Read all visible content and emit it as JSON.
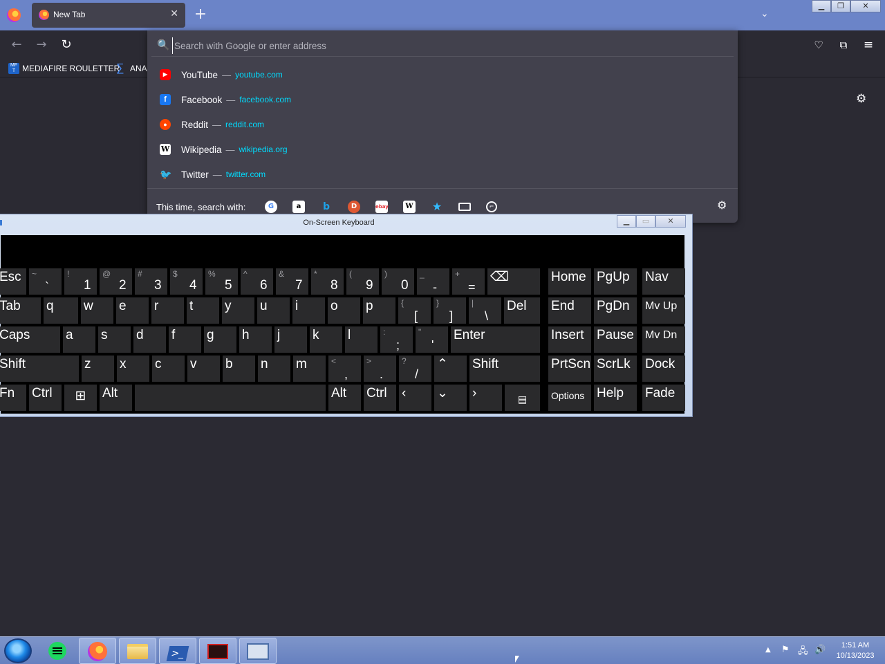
{
  "browser": {
    "tab_title": "New Tab",
    "tab_close": "✕",
    "new_tab": "+",
    "list_tabs": "⌄"
  },
  "bookmarks": [
    {
      "label": "MEDIAFIRE ROULETTER",
      "icon": "mediafire-icon"
    },
    {
      "label": "ANA",
      "icon": "sigma-icon"
    }
  ],
  "urlbar": {
    "placeholder": "Search with Google or enter address",
    "value": ""
  },
  "suggestions": [
    {
      "name": "YouTube",
      "url": "youtube.com",
      "icon": "youtube-icon"
    },
    {
      "name": "Facebook",
      "url": "facebook.com",
      "icon": "facebook-icon"
    },
    {
      "name": "Reddit",
      "url": "reddit.com",
      "icon": "reddit-icon"
    },
    {
      "name": "Wikipedia",
      "url": "wikipedia.org",
      "icon": "wikipedia-icon"
    },
    {
      "name": "Twitter",
      "url": "twitter.com",
      "icon": "twitter-icon"
    }
  ],
  "dash": "—",
  "oneoff": {
    "label": "This time, search with:",
    "engines": [
      "google-icon",
      "amazon-icon",
      "bing-icon",
      "duckduckgo-icon",
      "ebay-icon",
      "wikipedia-icon",
      "bookmarks-icon",
      "tabs-icon",
      "history-icon"
    ]
  },
  "osk": {
    "title": "On-Screen Keyboard",
    "rows": {
      "r1": [
        {
          "main": "Esc"
        },
        {
          "shift": "~",
          "low": "`"
        },
        {
          "shift": "!",
          "low": "1"
        },
        {
          "shift": "@",
          "low": "2"
        },
        {
          "shift": "#",
          "low": "3"
        },
        {
          "shift": "$",
          "low": "4"
        },
        {
          "shift": "%",
          "low": "5"
        },
        {
          "shift": "^",
          "low": "6"
        },
        {
          "shift": "&",
          "low": "7"
        },
        {
          "shift": "*",
          "low": "8"
        },
        {
          "shift": "(",
          "low": "9"
        },
        {
          "shift": ")",
          "low": "0"
        },
        {
          "shift": "_",
          "low": "-"
        },
        {
          "shift": "+",
          "low": "="
        },
        {
          "main": "⌫"
        },
        {
          "main": "Home"
        },
        {
          "main": "PgUp"
        },
        {
          "main": "Nav"
        }
      ],
      "r2": [
        {
          "main": "Tab"
        },
        {
          "main": "q"
        },
        {
          "main": "w"
        },
        {
          "main": "e"
        },
        {
          "main": "r"
        },
        {
          "main": "t"
        },
        {
          "main": "y"
        },
        {
          "main": "u"
        },
        {
          "main": "i"
        },
        {
          "main": "o"
        },
        {
          "main": "p"
        },
        {
          "shift": "{",
          "low": "["
        },
        {
          "shift": "}",
          "low": "]"
        },
        {
          "shift": "|",
          "low": "\\"
        },
        {
          "main": "Del"
        },
        {
          "main": "End"
        },
        {
          "main": "PgDn"
        },
        {
          "main": "Mv Up"
        }
      ],
      "r3": [
        {
          "main": "Caps"
        },
        {
          "main": "a"
        },
        {
          "main": "s"
        },
        {
          "main": "d"
        },
        {
          "main": "f"
        },
        {
          "main": "g"
        },
        {
          "main": "h"
        },
        {
          "main": "j"
        },
        {
          "main": "k"
        },
        {
          "main": "l"
        },
        {
          "shift": ":",
          "low": ";"
        },
        {
          "shift": "\"",
          "low": "'"
        },
        {
          "main": "Enter"
        },
        {
          "main": "Insert"
        },
        {
          "main": "Pause"
        },
        {
          "main": "Mv Dn"
        }
      ],
      "r4": [
        {
          "main": "Shift"
        },
        {
          "main": "z"
        },
        {
          "main": "x"
        },
        {
          "main": "c"
        },
        {
          "main": "v"
        },
        {
          "main": "b"
        },
        {
          "main": "n"
        },
        {
          "main": "m"
        },
        {
          "shift": "<",
          "low": ","
        },
        {
          "shift": ">",
          "low": "."
        },
        {
          "shift": "?",
          "low": "/"
        },
        {
          "main": "⌃"
        },
        {
          "main": "Shift"
        },
        {
          "main": "PrtScn"
        },
        {
          "main": "ScrLk"
        },
        {
          "main": "Dock"
        }
      ],
      "r5": [
        {
          "main": "Fn"
        },
        {
          "main": "Ctrl"
        },
        {
          "main": "⊞"
        },
        {
          "main": "Alt"
        },
        {
          "main": ""
        },
        {
          "main": "Alt"
        },
        {
          "main": "Ctrl"
        },
        {
          "main": "‹"
        },
        {
          "main": "⌄"
        },
        {
          "main": "›"
        },
        {
          "main": "▤"
        },
        {
          "main": "Options"
        },
        {
          "main": "Help"
        },
        {
          "main": "Fade"
        }
      ]
    }
  },
  "taskbar": {
    "apps": [
      "spotify-icon",
      "firefox-icon",
      "file-explorer-icon",
      "powershell-icon",
      "app-icon",
      "on-screen-keyboard-icon"
    ],
    "time": "1:51 AM",
    "date": "10/13/2023"
  }
}
